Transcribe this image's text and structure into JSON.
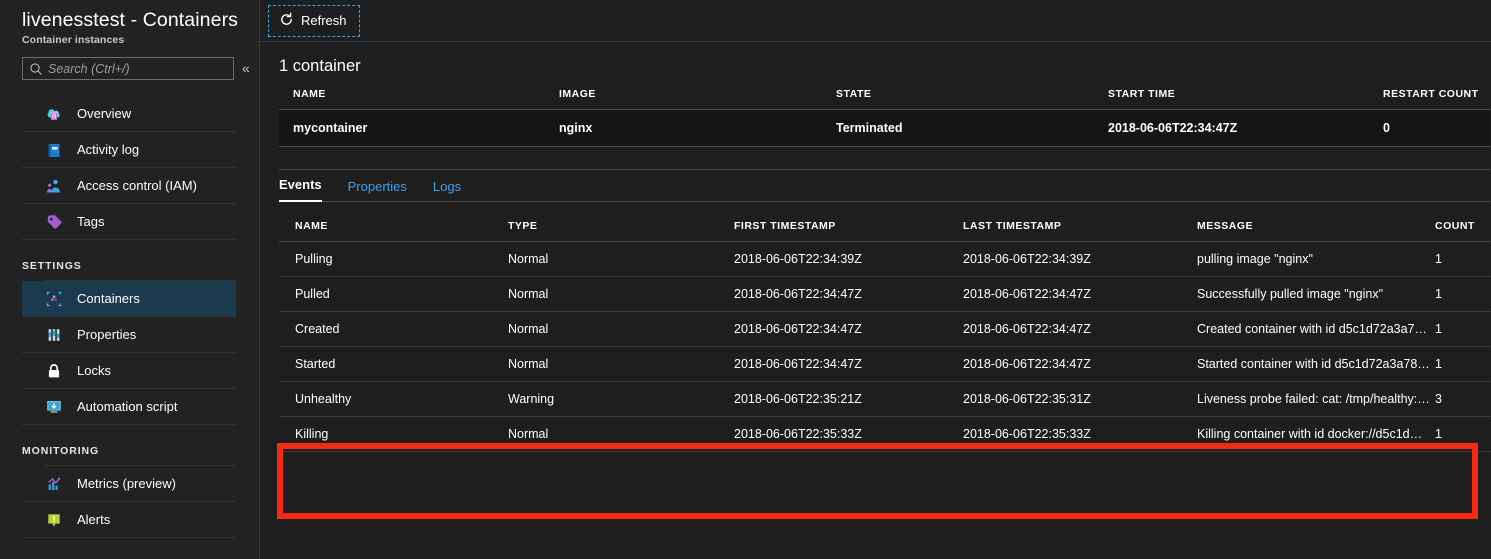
{
  "blade": {
    "title": "livenesstest - Containers",
    "subtitle": "Container instances",
    "collapse_icon": "chevron-double-left-icon"
  },
  "search": {
    "placeholder": "Search (Ctrl+/)",
    "value": "",
    "icon": "search-icon"
  },
  "sidebar": {
    "items": [
      {
        "label": "Overview",
        "icon": "cloud-overview-icon",
        "selected": false
      },
      {
        "label": "Activity log",
        "icon": "activity-log-icon",
        "selected": false
      },
      {
        "label": "Access control (IAM)",
        "icon": "access-control-icon",
        "selected": false
      },
      {
        "label": "Tags",
        "icon": "tag-icon",
        "selected": false
      }
    ],
    "groups": [
      {
        "title": "SETTINGS",
        "items": [
          {
            "label": "Containers",
            "icon": "containers-icon",
            "selected": true
          },
          {
            "label": "Properties",
            "icon": "properties-icon",
            "selected": false
          },
          {
            "label": "Locks",
            "icon": "lock-icon",
            "selected": false
          },
          {
            "label": "Automation script",
            "icon": "automation-script-icon",
            "selected": false
          }
        ]
      },
      {
        "title": "MONITORING",
        "items": [
          {
            "label": "Metrics (preview)",
            "icon": "metrics-icon",
            "selected": false
          },
          {
            "label": "Alerts",
            "icon": "alerts-icon",
            "selected": false
          }
        ]
      }
    ]
  },
  "toolbar": {
    "refresh_label": "Refresh",
    "refresh_icon": "refresh-icon"
  },
  "containers_section": {
    "count_label": "1 container",
    "columns": [
      "NAME",
      "IMAGE",
      "STATE",
      "START TIME",
      "RESTART COUNT"
    ],
    "rows": [
      {
        "name": "mycontainer",
        "image": "nginx",
        "state": "Terminated",
        "start_time": "2018-06-06T22:34:47Z",
        "restart_count": "0"
      }
    ]
  },
  "tabs": [
    {
      "label": "Events",
      "active": true
    },
    {
      "label": "Properties",
      "active": false
    },
    {
      "label": "Logs",
      "active": false
    }
  ],
  "events_section": {
    "columns": [
      "NAME",
      "TYPE",
      "FIRST TIMESTAMP",
      "LAST TIMESTAMP",
      "MESSAGE",
      "COUNT"
    ],
    "rows": [
      {
        "name": "Pulling",
        "type": "Normal",
        "first_timestamp": "2018-06-06T22:34:39Z",
        "last_timestamp": "2018-06-06T22:34:39Z",
        "message": "pulling image \"nginx\"",
        "count": "1",
        "highlighted": false
      },
      {
        "name": "Pulled",
        "type": "Normal",
        "first_timestamp": "2018-06-06T22:34:47Z",
        "last_timestamp": "2018-06-06T22:34:47Z",
        "message": "Successfully pulled image \"nginx\"",
        "count": "1",
        "highlighted": false
      },
      {
        "name": "Created",
        "type": "Normal",
        "first_timestamp": "2018-06-06T22:34:47Z",
        "last_timestamp": "2018-06-06T22:34:47Z",
        "message": "Created container with id d5c1d72a3a7…",
        "count": "1",
        "highlighted": false
      },
      {
        "name": "Started",
        "type": "Normal",
        "first_timestamp": "2018-06-06T22:34:47Z",
        "last_timestamp": "2018-06-06T22:34:47Z",
        "message": "Started container with id d5c1d72a3a78…",
        "count": "1",
        "highlighted": false
      },
      {
        "name": "Unhealthy",
        "type": "Warning",
        "first_timestamp": "2018-06-06T22:35:21Z",
        "last_timestamp": "2018-06-06T22:35:31Z",
        "message": "Liveness probe failed: cat: /tmp/healthy:…",
        "count": "3",
        "highlighted": true
      },
      {
        "name": "Killing",
        "type": "Normal",
        "first_timestamp": "2018-06-06T22:35:33Z",
        "last_timestamp": "2018-06-06T22:35:33Z",
        "message": "Killing container with id docker://d5c1d…",
        "count": "1",
        "highlighted": true
      }
    ]
  },
  "annotation": {
    "highlight_color": "#f42b12"
  },
  "colors": {
    "background": "#1e1e1e",
    "sidebar_background": "#222222",
    "selected_nav": "#1b3a4d",
    "link_blue": "#3aa0f3",
    "focus_outline": "#2aa8e0"
  }
}
